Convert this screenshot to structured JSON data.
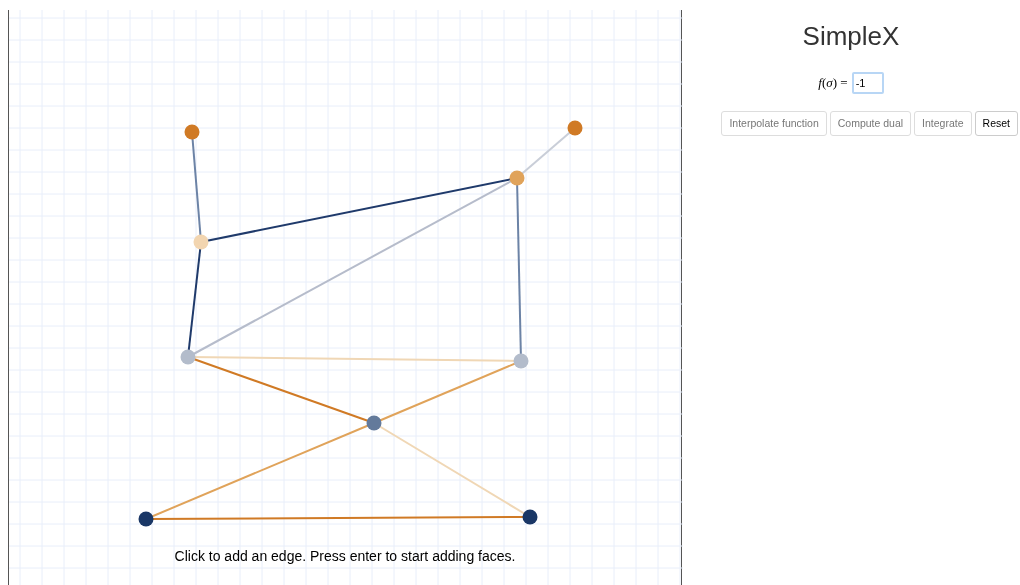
{
  "canvas": {
    "hint": "Click to add an edge. Press enter to start adding faces.",
    "vertices": [
      {
        "color": "#d07a25"
      },
      {
        "color": "#d07a25"
      },
      {
        "color": "#e0a35a"
      },
      {
        "color": "#f2d5b0"
      },
      {
        "color": "#b3bccb"
      },
      {
        "color": "#b3bccb"
      },
      {
        "color": "#637a9b"
      },
      {
        "color": "#1a3766"
      },
      {
        "color": "#1a3766"
      }
    ],
    "edges": [
      {
        "color": "#6c83a6"
      },
      {
        "color": "#1f3a6b"
      },
      {
        "color": "#c9ced8"
      },
      {
        "color": "#b6bccb"
      },
      {
        "color": "#6c83a6"
      },
      {
        "color": "#1f3a6b"
      },
      {
        "color": "#f0d7b5"
      },
      {
        "color": "#d07a25"
      },
      {
        "color": "#e0a35a"
      },
      {
        "color": "#e0a35a"
      },
      {
        "color": "#f0d7b5"
      },
      {
        "color": "#d07a25"
      }
    ]
  },
  "panel": {
    "title": "SimpleX",
    "function_label": "*f*(*σ*) =",
    "function_value": "-1",
    "buttons": [
      {
        "label": "Interpolate function",
        "disabled": true
      },
      {
        "label": "Compute dual",
        "disabled": true
      },
      {
        "label": "Integrate",
        "disabled": true
      },
      {
        "label": "Reset",
        "disabled": false
      }
    ]
  }
}
